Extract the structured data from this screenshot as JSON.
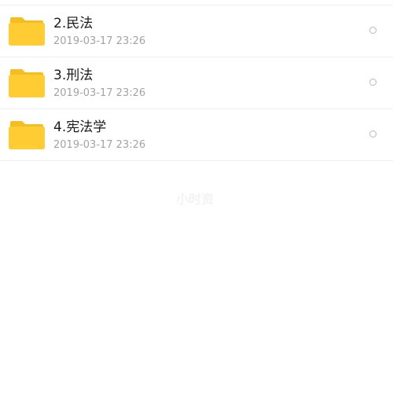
{
  "files": [
    {
      "name": "2.民法",
      "date": "2019-03-17 23:26"
    },
    {
      "name": "3.刑法",
      "date": "2019-03-17 23:26"
    },
    {
      "name": "4.宪法学",
      "date": "2019-03-17 23:26"
    }
  ],
  "watermark": "小时资",
  "colors": {
    "folder": "#FFCC33",
    "folder_tab": "#F5BD22",
    "divider": "#EEEEEE",
    "date_text": "#A3A3A3"
  },
  "icons": {
    "folder": "folder-icon",
    "select": "radio-button-icon"
  }
}
